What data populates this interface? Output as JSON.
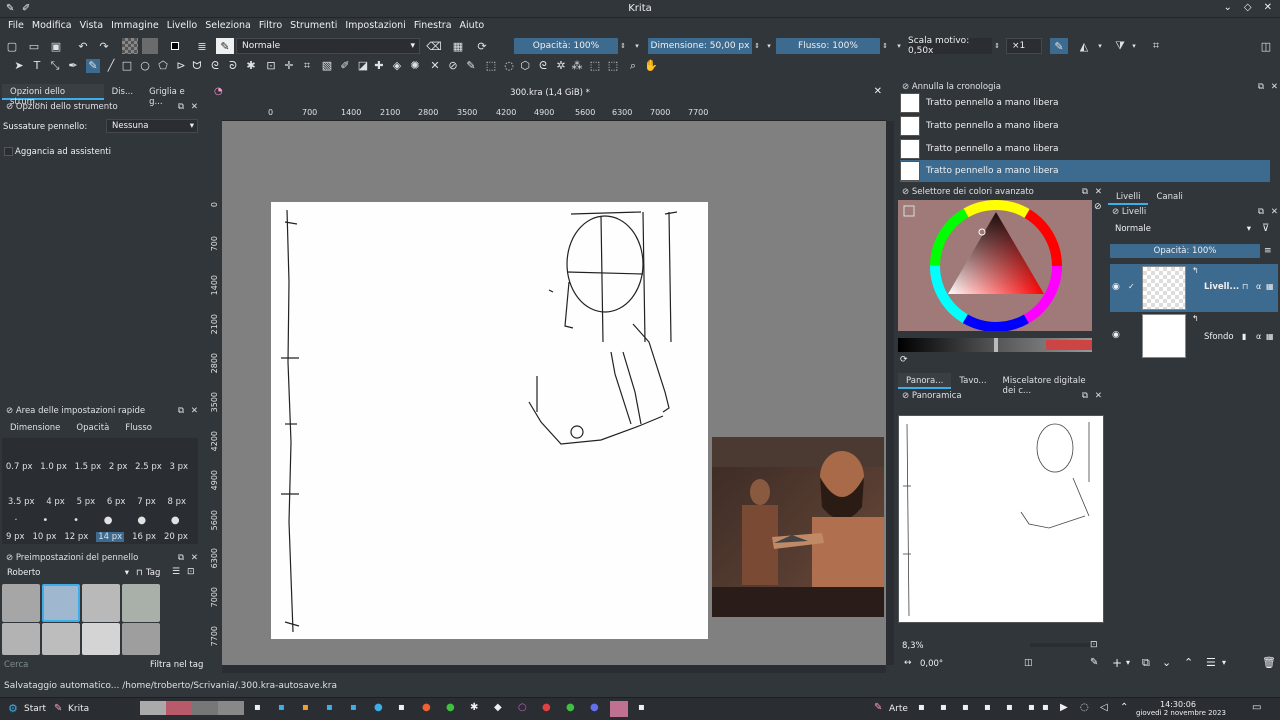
{
  "window": {
    "title": "Krita"
  },
  "menu": [
    "File",
    "Modifica",
    "Vista",
    "Immagine",
    "Livello",
    "Seleziona",
    "Filtro",
    "Strumenti",
    "Impostazioni",
    "Finestra",
    "Aiuto"
  ],
  "toolbar": {
    "blend_mode": "Normale",
    "opacity": "Opacità: 100%",
    "size": "Dimensione: 50,00 px",
    "flow": "Flusso: 100%",
    "pattern_scale": "Scala motivo: 0,50x",
    "multiplier": "×1"
  },
  "left_tabs": [
    "Opzioni dello strum...",
    "Dis...",
    "Griglia e g..."
  ],
  "tool_options": {
    "title": "Opzioni dello strumento",
    "smoothing_label": "Sussature pennello:",
    "smoothing_value": "Nessuna",
    "snap_label": "Aggancia ad assistenti"
  },
  "quick_settings": {
    "title": "Area delle impostazioni rapide",
    "tabs": [
      "Dimensione",
      "Opacità",
      "Flusso"
    ],
    "row1": [
      "0.7 px",
      "1.0 px",
      "1.5 px",
      "2 px",
      "2.5 px",
      "3 px"
    ],
    "row2": [
      "3.5 px",
      "4 px",
      "5 px",
      "6 px",
      "7 px",
      "8 px"
    ],
    "row3": [
      "9 px",
      "10 px",
      "12 px",
      "14 px",
      "16 px",
      "20 px"
    ],
    "selected": "14 px"
  },
  "brush_presets": {
    "title": "Preimpostazioni del pennello",
    "preset": "Roberto",
    "tag_label": "Tag",
    "search_placeholder": "Cerca",
    "filter_label": "Filtra nel tag"
  },
  "document": {
    "tab_title": "300.kra (1,4 GiB) *"
  },
  "ruler": {
    "h": [
      "0",
      "700",
      "1400",
      "2100",
      "2800",
      "3500",
      "4200",
      "4900",
      "5600",
      "6300",
      "7000",
      "7700"
    ],
    "v": [
      "0",
      "700",
      "1400",
      "2100",
      "2800",
      "3500",
      "4200",
      "4900",
      "5600",
      "6300",
      "7000",
      "7700"
    ]
  },
  "history": {
    "title": "Annulla la cronologia",
    "items": [
      "Tratto pennello a mano libera",
      "Tratto pennello a mano libera",
      "Tratto pennello a mano libera",
      "Tratto pennello a mano libera"
    ]
  },
  "color_selector": {
    "title": "Selettore dei colori avanzato",
    "bg_color": "#a07a78"
  },
  "bottom_tabs": [
    "Panora...",
    "Tavo...",
    "Miscelatore digitale dei c..."
  ],
  "overview": {
    "title": "Panoramica",
    "zoom": "8,3%",
    "rotation": "0,00°"
  },
  "layers": {
    "tabs": [
      "Livelli",
      "Canali"
    ],
    "title": "Livelli",
    "blend": "Normale",
    "opacity": "Opacità: 100%",
    "items": [
      {
        "name": "Livell..."
      },
      {
        "name": "Sfondo"
      }
    ]
  },
  "status": {
    "text": "Salvataggio automatico... /home/troberto/Scrivania/.300.kra-autosave.kra"
  },
  "taskbar": {
    "start": "Start",
    "app": "Krita",
    "arte": "Arte",
    "time": "14:30:06",
    "date": "giovedì 2 novembre 2023"
  }
}
